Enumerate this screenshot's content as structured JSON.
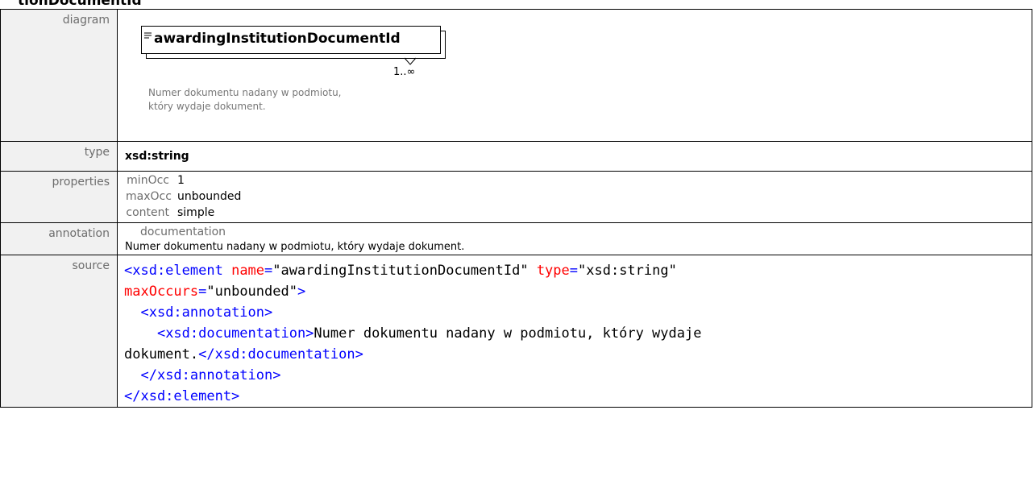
{
  "page": {
    "heading": "tionDocumentId"
  },
  "labels": {
    "diagram": "diagram",
    "type": "type",
    "properties": "properties",
    "annotation": "annotation",
    "source": "source"
  },
  "diagram": {
    "element_name": "awardingInstitutionDocumentId",
    "multiplicity": "1..∞",
    "doc_line1": "Numer dokumentu nadany w podmiotu,",
    "doc_line2": "który wydaje dokument."
  },
  "type_value": "xsd:string",
  "properties": [
    {
      "key": "minOcc",
      "value": "1"
    },
    {
      "key": "maxOcc",
      "value": "unbounded"
    },
    {
      "key": "content",
      "value": "simple"
    }
  ],
  "annotation": {
    "key": "documentation",
    "value": "Numer dokumentu nadany w podmiotu, który wydaje dokument."
  },
  "source": {
    "open_tag": "<xsd:element",
    "attr_name": "name",
    "attr_name_val": "\"awardingInstitutionDocumentId\"",
    "attr_type": "type",
    "attr_type_val": "\"xsd:string\"",
    "attr_max": "maxOccurs",
    "attr_max_val": "\"unbounded\"",
    "close_bracket": ">",
    "annotation_open": "<xsd:annotation>",
    "doc_open": "<xsd:documentation>",
    "doc_text_1": "Numer dokumentu nadany w podmiotu, który wydaje",
    "doc_text_2": "dokument.",
    "doc_close": "</xsd:documentation>",
    "annotation_close": "</xsd:annotation>",
    "element_close": "</xsd:element>"
  }
}
